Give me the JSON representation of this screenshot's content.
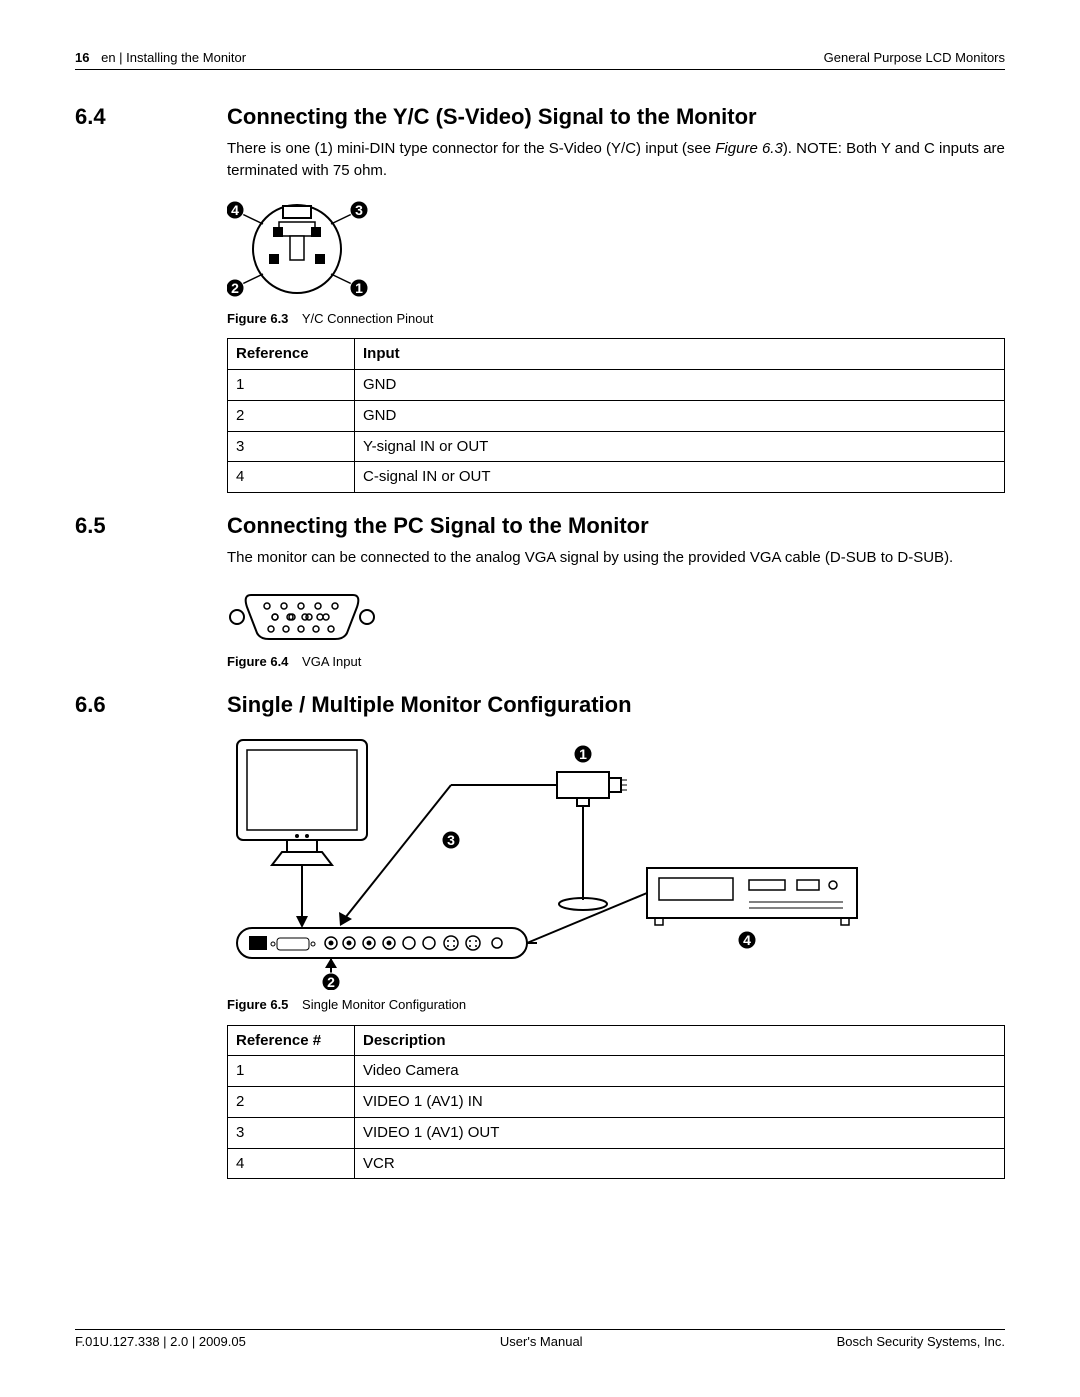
{
  "header": {
    "page_number": "16",
    "breadcrumb": "en | Installing the Monitor",
    "doc_title": "General Purpose LCD Monitors"
  },
  "sections": {
    "s64": {
      "num": "6.4",
      "title": "Connecting the Y/C (S-Video) Signal to the Monitor",
      "para_a": "There is one (1) mini-DIN type connector for the S-Video (Y/C) input (see ",
      "para_ref": "Figure 6.3",
      "para_b": "). NOTE: Both Y and C inputs are terminated with 75 ohm.",
      "fig_label": "Figure 6.3",
      "fig_title": "Y/C Connection Pinout",
      "table": {
        "h1": "Reference",
        "h2": "Input",
        "rows": [
          {
            "r": "1",
            "v": "GND"
          },
          {
            "r": "2",
            "v": "GND"
          },
          {
            "r": "3",
            "v": "Y-signal IN or OUT"
          },
          {
            "r": "4",
            "v": "C-signal IN or OUT"
          }
        ]
      }
    },
    "s65": {
      "num": "6.5",
      "title": "Connecting the PC Signal to the Monitor",
      "para": "The monitor can be connected to the analog VGA signal by using the provided VGA cable (D-SUB to D-SUB).",
      "fig_label": "Figure 6.4",
      "fig_title": "VGA Input"
    },
    "s66": {
      "num": "6.6",
      "title": "Single / Multiple Monitor Configuration",
      "fig_label": "Figure 6.5",
      "fig_title": "Single Monitor Configuration",
      "table": {
        "h1": "Reference #",
        "h2": "Description",
        "rows": [
          {
            "r": "1",
            "v": "Video Camera"
          },
          {
            "r": "2",
            "v": "VIDEO 1 (AV1) IN"
          },
          {
            "r": "3",
            "v": "VIDEO 1 (AV1) OUT"
          },
          {
            "r": "4",
            "v": "VCR"
          }
        ]
      }
    }
  },
  "footer": {
    "left": "F.01U.127.338 | 2.0 | 2009.05",
    "center": "User's Manual",
    "right": "Bosch Security Systems, Inc."
  }
}
